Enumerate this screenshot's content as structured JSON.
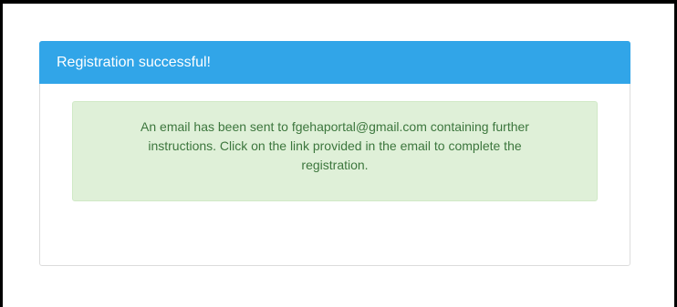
{
  "panel": {
    "title": "Registration successful!",
    "header_color": "#31a5e8"
  },
  "alert": {
    "line1": "An email has been sent to fgehaportal@gmail.com containing further",
    "line2": "instructions. Click on the link provided in the email to complete the",
    "line3": "registration.",
    "background_color": "#dff0d8",
    "text_color": "#3c763d"
  }
}
